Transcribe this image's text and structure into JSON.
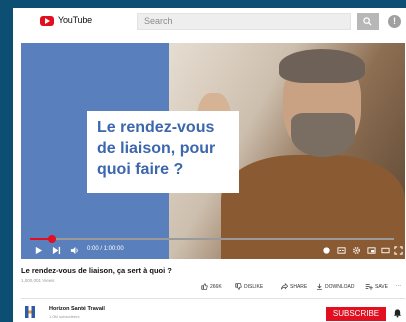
{
  "brand": {
    "name": "YouTube",
    "color": "#e10f1f"
  },
  "search": {
    "placeholder": "Search"
  },
  "video": {
    "overlay_text": "Le rendez-vous de liaison, pour quoi faire ?",
    "time": "0:00 / 1:00:00",
    "progress": 0.06,
    "title": "Le rendez-vous de liaison, ça sert à quoi ?",
    "views": "1,000,001 Views"
  },
  "actions": {
    "like": "266K",
    "dislike": "DISLIKE",
    "share": "SHARE",
    "download": "DOWNLOAD",
    "save": "SAVE",
    "more": "···"
  },
  "channel": {
    "name": "Horizon Santé Travail",
    "subs": "1.0M subscribers",
    "subscribe_label": "SUBSCRIBE"
  }
}
